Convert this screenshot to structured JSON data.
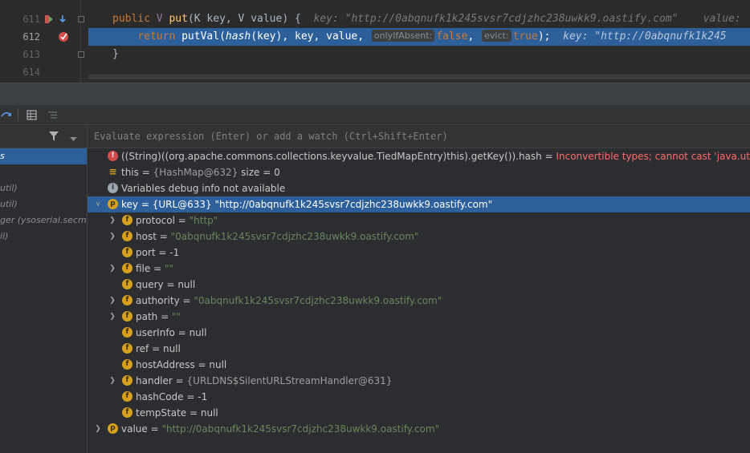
{
  "editor": {
    "lines": [
      {
        "num": "611",
        "code_pre": "public ",
        "type_param": "V ",
        "method": "put",
        "code_post": "(K key, V value) {",
        "hint": "  key: \"http://0abqnufk1k245svsr7cdjzhc238uwkk9.oastify.com\"    value:"
      },
      {
        "num": "612",
        "code_pre": "    return ",
        "method": "putVal",
        "code_post_a": "(",
        "hash_call": "hash",
        "code_post_b": "(key), key, value, ",
        "chip1": "onlyIfAbsent:",
        "val1": "false",
        "sep": ", ",
        "chip2": "evict:",
        "val2": "true",
        "code_end": ");",
        "hint": "  key: \"http://0abqnufk1k245"
      },
      {
        "num": "613",
        "code": "}"
      },
      {
        "num": "614",
        "code": ""
      }
    ]
  },
  "frames": {
    "rows": [
      {
        "text": "s"
      },
      {
        "text": ""
      },
      {
        "text": "util)"
      },
      {
        "text": "util)"
      },
      {
        "text": "ger (ysoserial.secmgr"
      },
      {
        "text": "il)"
      }
    ]
  },
  "watch": {
    "placeholder": "Evaluate expression (Enter) or add a watch (Ctrl+Shift+Enter)"
  },
  "variables": [
    {
      "kind": "err",
      "text": "((String)((org.apache.commons.collections.keyvalue.TiedMapEntry)this).getKey()).hash = ",
      "error": "Inconvertible types; cannot cast 'java.util.HashMap<K,V>' t"
    },
    {
      "kind": "stack",
      "name": "this",
      "ref": "{HashMap@632}",
      "tail": " size = 0"
    },
    {
      "kind": "info",
      "text": "Variables debug info not available"
    },
    {
      "kind": "p",
      "expanded": true,
      "selected": true,
      "name": "key",
      "ref": "{URL@633}",
      "str": "\"http://0abqnufk1k245svsr7cdjzhc238uwkk9.oastify.com\""
    },
    {
      "kind": "f",
      "arrow": true,
      "name": "protocol",
      "str": "\"http\""
    },
    {
      "kind": "f",
      "arrow": true,
      "name": "host",
      "str": "\"0abqnufk1k245svsr7cdjzhc238uwkk9.oastify.com\""
    },
    {
      "kind": "f",
      "name": "port",
      "num": "-1"
    },
    {
      "kind": "f",
      "arrow": true,
      "name": "file",
      "str": "\"\""
    },
    {
      "kind": "f",
      "name": "query",
      "num": "null"
    },
    {
      "kind": "f",
      "arrow": true,
      "name": "authority",
      "str": "\"0abqnufk1k245svsr7cdjzhc238uwkk9.oastify.com\""
    },
    {
      "kind": "f",
      "arrow": true,
      "name": "path",
      "str": "\"\""
    },
    {
      "kind": "f",
      "name": "userInfo",
      "num": "null"
    },
    {
      "kind": "f",
      "name": "ref",
      "num": "null"
    },
    {
      "kind": "f",
      "name": "hostAddress",
      "num": "null"
    },
    {
      "kind": "f",
      "arrow": true,
      "name": "handler",
      "ref": "{URLDNS$SilentURLStreamHandler@631}"
    },
    {
      "kind": "f",
      "name": "hashCode",
      "num": "-1"
    },
    {
      "kind": "f",
      "name": "tempState",
      "num": "null"
    },
    {
      "kind": "p",
      "arrow": true,
      "level0": true,
      "name": "value",
      "str": "\"http://0abqnufk1k245svsr7cdjzhc238uwkk9.oastify.com\""
    }
  ],
  "colors": {
    "selection": "#2d5f9a",
    "string": "#6a8759",
    "field_icon": "#d5a11e",
    "error": "#ff6b68"
  },
  "icons": [
    "breakpoint-icon",
    "fold-icon",
    "filter-icon",
    "table-icon",
    "list-icon",
    "expand-arrow-icon",
    "field-icon",
    "parameter-icon",
    "error-icon",
    "info-icon"
  ]
}
